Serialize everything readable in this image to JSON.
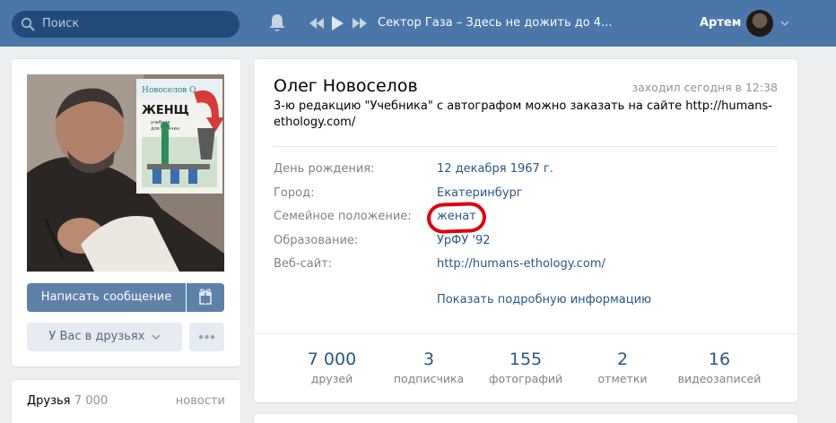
{
  "header": {
    "search_placeholder": "Поиск",
    "player_track": "Сектор Газа – Здесь не дожить до 4...",
    "user_name": "Артем"
  },
  "profile": {
    "actions": {
      "message": "Написать сообщение",
      "friend_status": "У Вас в друзьях"
    },
    "name": "Олег Новоселов",
    "last_seen": "заходил сегодня в 12:38",
    "status": "3-ю редакцию \"Учебника\" с автографом можно заказать на сайте http://humans-ethology.com/",
    "info": [
      {
        "label": "День рождения:",
        "value": "12 декабря 1967 г."
      },
      {
        "label": "Город:",
        "value": "Екатеринбург"
      },
      {
        "label": "Семейное положение:",
        "value": "женат"
      },
      {
        "label": "Образование:",
        "value": "УрФУ '92"
      },
      {
        "label": "Веб-сайт:",
        "value": "http://humans-ethology.com/"
      }
    ],
    "show_more": "Показать подробную информацию",
    "counters": [
      {
        "value": "7 000",
        "label": "друзей"
      },
      {
        "value": "3",
        "label": "подписчика"
      },
      {
        "value": "155",
        "label": "фотографий"
      },
      {
        "value": "2",
        "label": "отметки"
      },
      {
        "value": "16",
        "label": "видеозаписей"
      }
    ]
  },
  "friends_block": {
    "title": "Друзья",
    "count": "7 000",
    "link": "новости"
  },
  "book_cover": {
    "author": "Новоселов О.",
    "title": "ЖЕНЩ",
    "subtitle": "учебник для мужчин"
  },
  "colors": {
    "header_bg": "#4a76a8",
    "link": "#2a5885",
    "highlight_circle": "#e0000c"
  }
}
